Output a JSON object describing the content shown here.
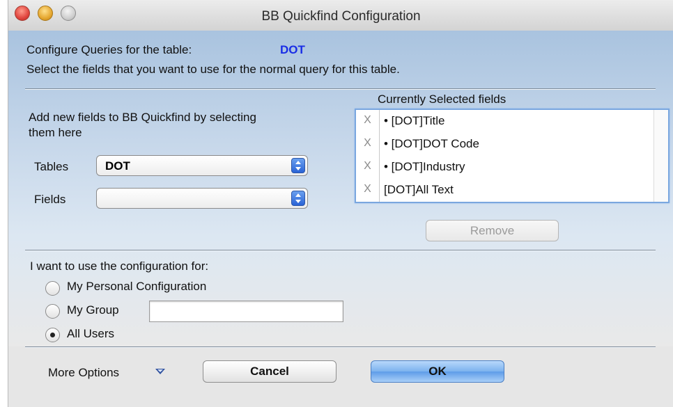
{
  "window": {
    "title": "BB Quickfind Configuration"
  },
  "header": {
    "configure_label": "Configure Queries for the table:",
    "table_name": "DOT",
    "instruction": "Select the fields that you want to use for the normal query for this table."
  },
  "left_panel": {
    "add_text_line1": "Add new fields to BB Quickfind by selecting",
    "add_text_line2": "them here",
    "tables_label": "Tables",
    "tables_value": "DOT",
    "fields_label": "Fields",
    "fields_value": ""
  },
  "selected_fields": {
    "title": "Currently Selected fields",
    "remove_x": "X",
    "items": [
      {
        "label": "• [DOT]Title"
      },
      {
        "label": "• [DOT]DOT Code"
      },
      {
        "label": "• [DOT]Industry"
      },
      {
        "label": "[DOT]All Text"
      }
    ],
    "remove_button": "Remove"
  },
  "usage": {
    "label": "I want to use the configuration for:",
    "options": [
      {
        "label": "My Personal Configuration",
        "selected": false
      },
      {
        "label": "My Group",
        "selected": false
      },
      {
        "label": "All Users",
        "selected": true
      }
    ],
    "group_value": ""
  },
  "footer": {
    "more_options": "More Options",
    "cancel": "Cancel",
    "ok": "OK"
  },
  "colors": {
    "table_name": "#1a2ee6",
    "panel_top": "#a9c3df",
    "default_button": "#7cb2ee"
  }
}
